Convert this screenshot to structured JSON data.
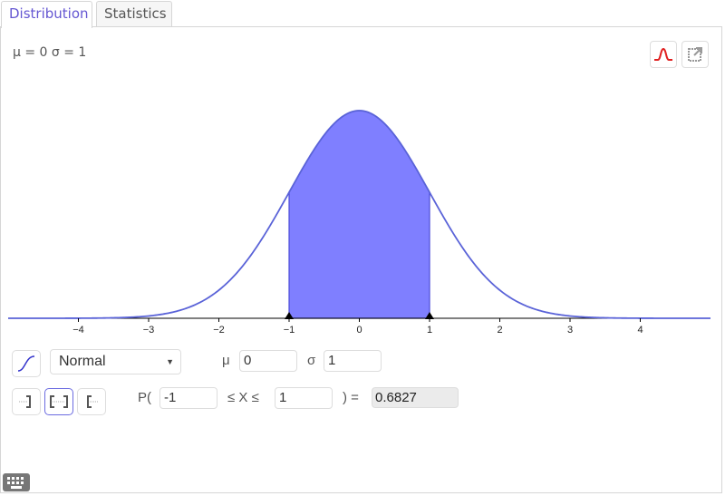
{
  "tabs": [
    {
      "label": "Distribution",
      "active": true
    },
    {
      "label": "Statistics",
      "active": false
    }
  ],
  "params_label": "μ = 0 σ = 1",
  "toolbar": {
    "overlay_normal_icon": "normal-curve-icon",
    "export_icon": "export-icon",
    "curve_color": "#e02020"
  },
  "chart_data": {
    "type": "area",
    "distribution": "Normal",
    "mean": 0,
    "sd": 1,
    "xlim": [
      -5,
      5
    ],
    "x_ticks": [
      -4,
      -3,
      -2,
      -1,
      0,
      1,
      2,
      3,
      4
    ],
    "x_tick_labels": [
      "−4",
      "−3",
      "−2",
      "−1",
      "0",
      "1",
      "2",
      "3",
      "4"
    ],
    "shaded_interval": [
      -1,
      1
    ],
    "markers": [
      -1,
      1
    ],
    "curve_color": "#5a63d8",
    "fill_color": "#7f7fff",
    "grid": false
  },
  "controls": {
    "cdf_toggle_icon": "cdf-curve-icon",
    "distribution_select": "Normal",
    "mu_label": "μ",
    "mu_value": "0",
    "sigma_label": "σ",
    "sigma_value": "1",
    "interval_buttons": [
      {
        "name": "left-sided",
        "selected": false
      },
      {
        "name": "two-sided",
        "selected": true
      },
      {
        "name": "right-sided",
        "selected": false
      }
    ],
    "prob_prefix": "P(",
    "lower_value": "-1",
    "between_label": "≤ X ≤",
    "upper_value": "1",
    "equals_label": ") =",
    "result_value": "0.6827"
  },
  "keyboard_icon": "keyboard-icon"
}
